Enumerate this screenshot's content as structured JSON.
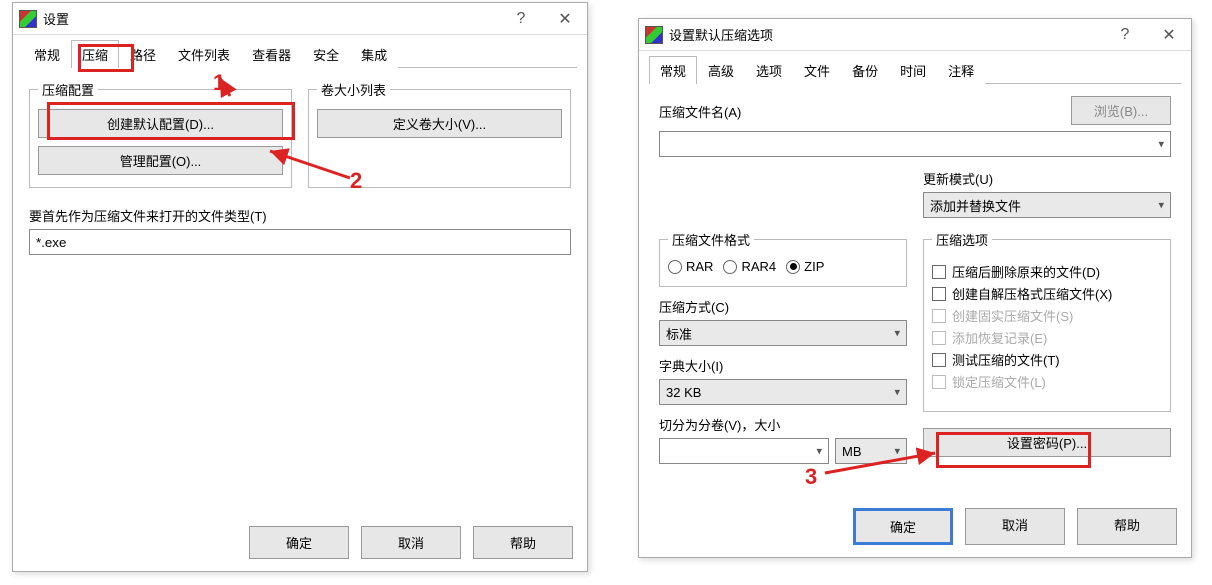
{
  "dialog1": {
    "title": "设置",
    "tabs": [
      "常规",
      "压缩",
      "路径",
      "文件列表",
      "查看器",
      "安全",
      "集成"
    ],
    "active_tab_index": 1,
    "group_compress_config": "压缩配置",
    "btn_create_default": "创建默认配置(D)...",
    "btn_manage": "管理配置(O)...",
    "group_volume_list": "卷大小列表",
    "btn_define_volume": "定义卷大小(V)...",
    "label_open_types": "要首先作为压缩文件来打开的文件类型(T)",
    "input_open_types": "*.exe",
    "btn_ok": "确定",
    "btn_cancel": "取消",
    "btn_help": "帮助"
  },
  "dialog2": {
    "title": "设置默认压缩选项",
    "tabs": [
      "常规",
      "高级",
      "选项",
      "文件",
      "备份",
      "时间",
      "注释"
    ],
    "active_tab_index": 0,
    "label_archive_name": "压缩文件名(A)",
    "btn_browse": "浏览(B)...",
    "archive_name_value": "",
    "label_update_mode": "更新模式(U)",
    "update_mode_value": "添加并替换文件",
    "group_format": "压缩文件格式",
    "formats": [
      {
        "label": "RAR",
        "checked": false
      },
      {
        "label": "RAR4",
        "checked": false
      },
      {
        "label": "ZIP",
        "checked": true
      }
    ],
    "label_method": "压缩方式(C)",
    "method_value": "标准",
    "label_dict": "字典大小(I)",
    "dict_value": "32 KB",
    "label_split": "切分为分卷(V)，大小",
    "split_value": "",
    "split_unit": "MB",
    "group_options": "压缩选项",
    "option_items": [
      {
        "label": "压缩后删除原来的文件(D)",
        "disabled": false
      },
      {
        "label": "创建自解压格式压缩文件(X)",
        "disabled": false
      },
      {
        "label": "创建固实压缩文件(S)",
        "disabled": true
      },
      {
        "label": "添加恢复记录(E)",
        "disabled": true
      },
      {
        "label": "测试压缩的文件(T)",
        "disabled": false
      },
      {
        "label": "锁定压缩文件(L)",
        "disabled": true
      }
    ],
    "btn_set_password": "设置密码(P)...",
    "btn_ok": "确定",
    "btn_cancel": "取消",
    "btn_help": "帮助"
  },
  "annotations": {
    "num1": "1",
    "num2": "2",
    "num3": "3"
  }
}
